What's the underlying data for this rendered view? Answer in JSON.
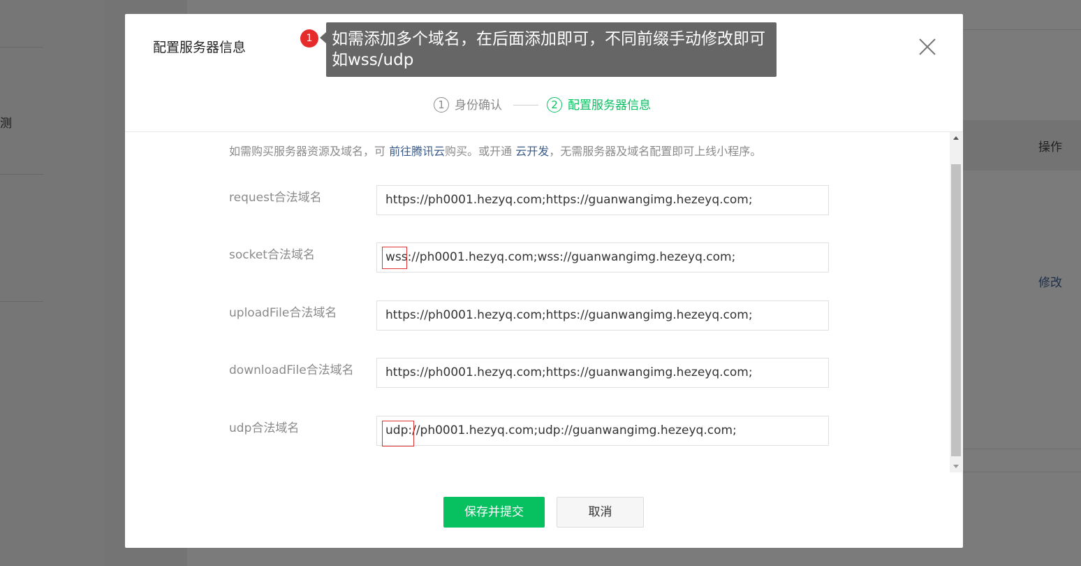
{
  "background": {
    "left_text": "测",
    "column_header": "操作",
    "row_action": "修改"
  },
  "dialog": {
    "title": "配置服务器信息",
    "steps": [
      {
        "number": "1",
        "label": "身份确认",
        "active": false
      },
      {
        "number": "2",
        "label": "配置服务器信息",
        "active": true
      }
    ],
    "notice": {
      "before": "如需购买服务器资源及域名，可 ",
      "link1": "前往腾讯云",
      "middle": "购买。或开通 ",
      "link2": "云开发",
      "after": "，无需服务器及域名配置即可上线小程序。"
    },
    "fields": [
      {
        "label": "request合法域名",
        "value": "https://ph0001.hezyq.com;https://guanwangimg.hezeyq.com;"
      },
      {
        "label": "socket合法域名",
        "value": "wss://ph0001.hezyq.com;wss://guanwangimg.hezeyq.com;"
      },
      {
        "label": "uploadFile合法域名",
        "value": "https://ph0001.hezyq.com;https://guanwangimg.hezeyq.com;"
      },
      {
        "label": "downloadFile合法域名",
        "value": "https://ph0001.hezyq.com;https://guanwangimg.hezeyq.com;"
      },
      {
        "label": "udp合法域名",
        "value": "udp://ph0001.hezyq.com;udp://guanwangimg.hezeyq.com;"
      }
    ],
    "buttons": {
      "save": "保存并提交",
      "cancel": "取消"
    }
  },
  "annotation": {
    "badge": "1",
    "line1": "如需添加多个域名，在后面添加即可，不同前缀手动修改即可",
    "line2": "如wss/udp"
  },
  "colors": {
    "accent": "#07c160",
    "link": "#3a5b8a",
    "annotation_red": "#e62b2b"
  },
  "icons": [
    "close-icon",
    "scroll-up-icon",
    "scroll-down-icon"
  ]
}
